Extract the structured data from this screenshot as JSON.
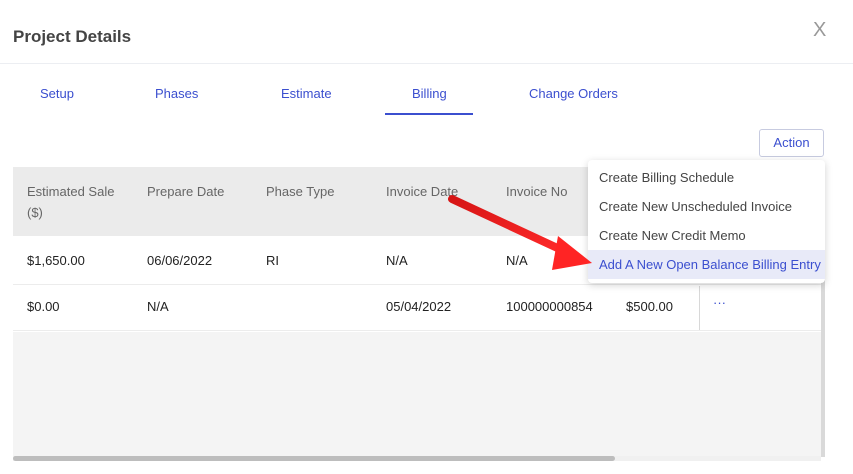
{
  "dialog": {
    "title": "Project Details",
    "close_glyph": "X"
  },
  "tabs": [
    {
      "label": "Setup"
    },
    {
      "label": "Phases"
    },
    {
      "label": "Estimate"
    },
    {
      "label": "Billing",
      "active": true
    },
    {
      "label": "Change Orders"
    }
  ],
  "action_label": "Action",
  "table": {
    "headers": [
      "Estimated Sale ($)",
      "Prepare Date",
      "Phase Type",
      "Invoice Date",
      "Invoice No"
    ],
    "rows": [
      [
        "$1,650.00",
        "06/06/2022",
        "RI",
        "N/A",
        "N/A",
        ""
      ],
      [
        "$0.00",
        "N/A",
        "",
        "05/04/2022",
        "100000000854",
        "$500.00"
      ]
    ],
    "row_menu_glyph": "···"
  },
  "action_menu": {
    "items": [
      "Create Billing Schedule",
      "Create New Unscheduled Invoice",
      "Create New Credit Memo",
      "Add A New Open Balance Billing Entry"
    ],
    "highlighted": "Add A New Open Balance Billing Entry"
  },
  "annotation": {
    "arrow_color": "#e02020"
  },
  "colors": {
    "accent": "#3b4fcf",
    "header_bg": "#ebebeb"
  }
}
